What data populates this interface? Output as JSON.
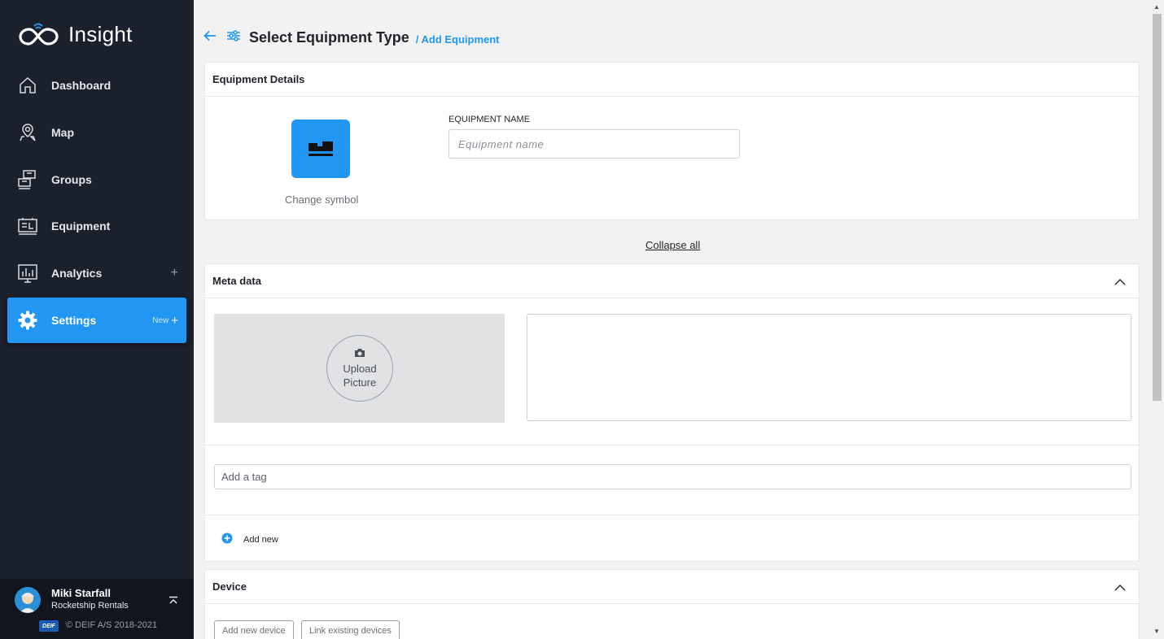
{
  "app": {
    "name": "Insight"
  },
  "sidebar": {
    "items": [
      {
        "label": "Dashboard",
        "icon": "home-icon"
      },
      {
        "label": "Map",
        "icon": "map-pin-icon"
      },
      {
        "label": "Groups",
        "icon": "groups-icon"
      },
      {
        "label": "Equipment",
        "icon": "equipment-icon"
      },
      {
        "label": "Analytics",
        "icon": "analytics-icon",
        "expand": "+"
      },
      {
        "label": "Settings",
        "icon": "gear-icon",
        "badge": "New",
        "expand": "+",
        "active": true
      }
    ],
    "user": {
      "name": "Miki Starfall",
      "org": "Rocketship Rentals"
    },
    "brand_logo": "DEIF",
    "copyright": "© DEIF A/S 2018-2021"
  },
  "header": {
    "title": "Select Equipment Type",
    "breadcrumb": "/ Add Equipment"
  },
  "equipment_details": {
    "title": "Equipment Details",
    "change_symbol": "Change symbol",
    "name_label": "EQUIPMENT NAME",
    "name_placeholder": "Equipment name",
    "name_value": ""
  },
  "collapse_all": "Collapse all",
  "meta_data": {
    "title": "Meta data",
    "upload_line1": "Upload",
    "upload_line2": "Picture",
    "tag_placeholder": "Add a tag",
    "add_new": "Add new"
  },
  "device": {
    "title": "Device",
    "add_new_device": "Add new device",
    "link_existing": "Link existing devices"
  },
  "colors": {
    "sidebar": "#1b212c",
    "accent": "#2196f3",
    "background": "#f2f2f2"
  }
}
